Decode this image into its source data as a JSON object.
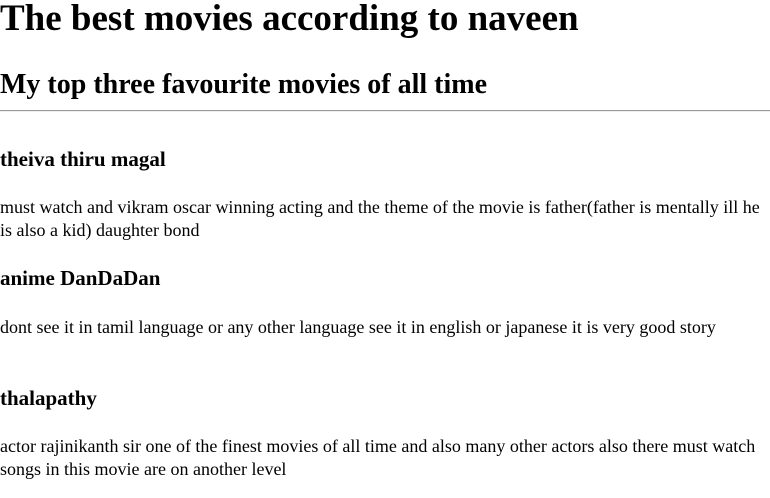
{
  "page": {
    "title": "The best movies according to naveen",
    "subtitle": "My top three favourite movies of all time"
  },
  "movies": [
    {
      "title": "theiva thiru magal",
      "description": "must watch and vikram oscar winning acting and the theme of the movie is father(father is mentally ill he is also a kid) daughter bond"
    },
    {
      "title": "anime DanDaDan",
      "description": "dont see it in tamil language or any other language see it in english or japanese it is very good story"
    },
    {
      "title": "thalapathy",
      "description": "actor rajinikanth sir one of the finest movies of all time and also many other actors also there must watch songs in this movie are on another level"
    }
  ]
}
